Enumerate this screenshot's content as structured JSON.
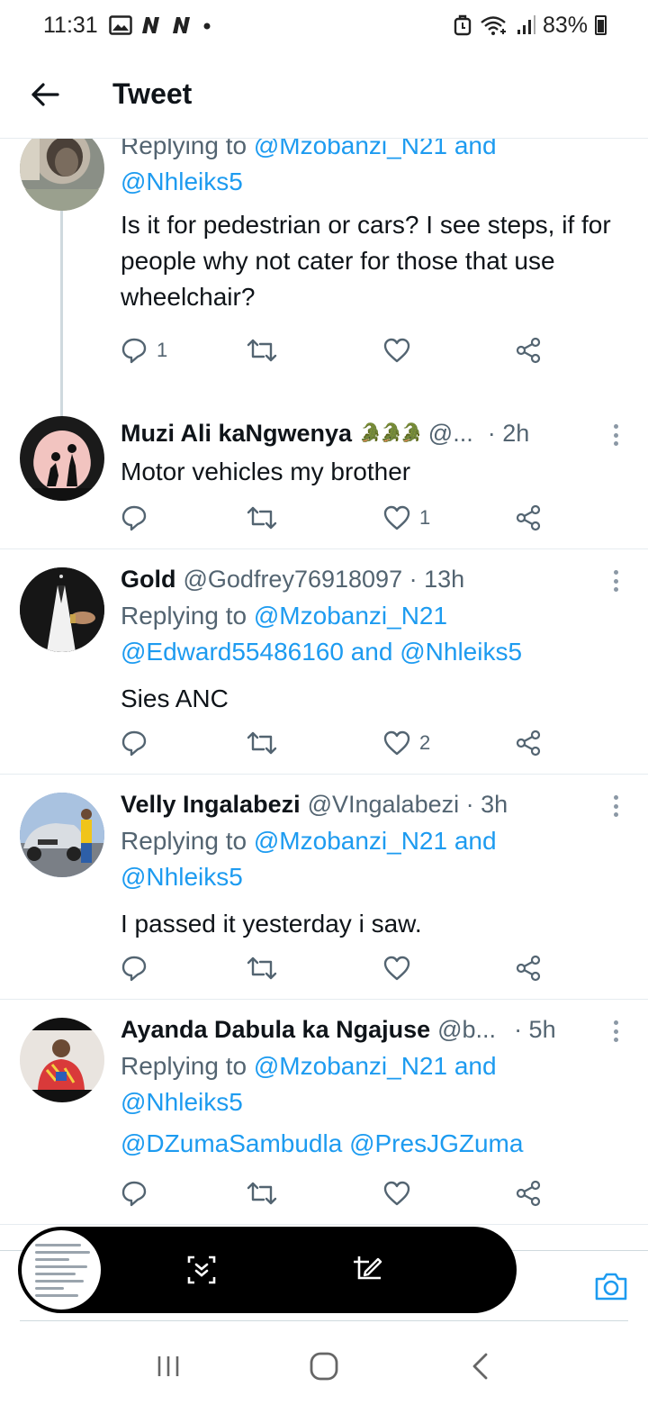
{
  "status_bar": {
    "time": "11:31",
    "battery": "83%"
  },
  "header": {
    "title": "Tweet"
  },
  "tweets": [
    {
      "reply_prefix": "Replying to",
      "mentions": [
        "@Mzobanzi_N21",
        "@Nhleiks5"
      ],
      "and": "and",
      "text": "Is it for pedestrian or cars? I see steps, if for people why not cater for those that use wheelchair?",
      "replies": "1"
    },
    {
      "name": "Muzi Ali kaNgwenya",
      "handle": "@...",
      "time": "· 2h",
      "emoji": "🐊🐊🐊",
      "text": "Motor vehicles my brother",
      "likes": "1"
    },
    {
      "name": "Gold",
      "handle": "@Godfrey76918097 · 13h",
      "reply_prefix": "Replying to",
      "mentions": [
        "@Mzobanzi_N21",
        "@Edward55486160",
        "@Nhleiks5"
      ],
      "and": "and",
      "text": "Sies ANC",
      "likes": "2"
    },
    {
      "name": "Velly Ingalabezi",
      "handle": "@VIngalabezi · 3h",
      "reply_prefix": "Replying to",
      "mentions": [
        "@Mzobanzi_N21",
        "@Nhleiks5"
      ],
      "and": "and",
      "text": "I passed it yesterday i saw."
    },
    {
      "name": "Ayanda Dabula ka Ngajuse",
      "handle": "@b...",
      "time": "· 5h",
      "reply_prefix": "Replying to",
      "mentions": [
        "@Mzobanzi_N21",
        "@Nhleiks5"
      ],
      "and": "and",
      "text_mentions": "@DZumaSambudla @PresJGZuma"
    }
  ],
  "colors": {
    "link": "#1d9bf0",
    "secondary": "#536471",
    "text": "#0f1419",
    "divider": "#e6ecf0"
  },
  "icons": [
    "back-arrow-icon",
    "reply-icon",
    "retweet-icon",
    "like-icon",
    "share-icon",
    "more-icon",
    "camera-icon",
    "scroll-capture-icon",
    "crop-edit-icon",
    "recent-apps-icon",
    "home-icon",
    "back-icon"
  ]
}
